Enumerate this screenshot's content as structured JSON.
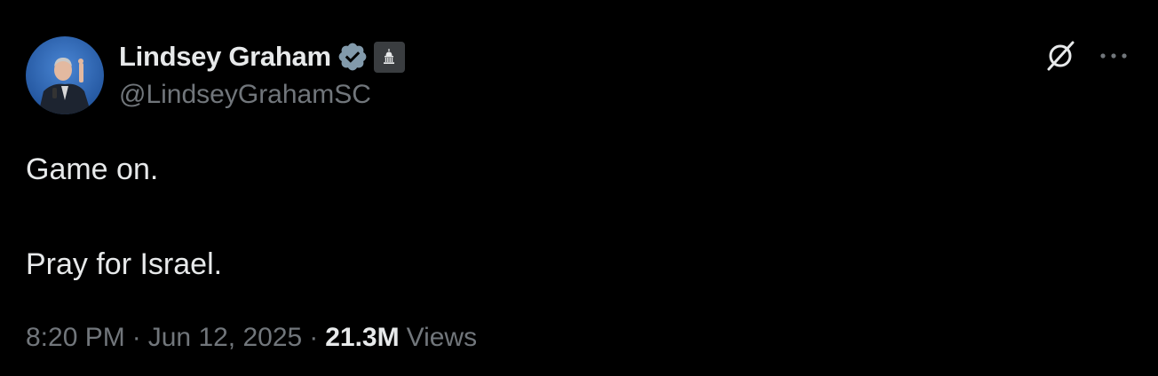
{
  "author": {
    "display_name": "Lindsey Graham",
    "handle": "@LindseyGrahamSC",
    "verified_icon": "verified-badge-icon",
    "affiliation_icon": "government-building-icon"
  },
  "tweet": {
    "lines": [
      "Game on.",
      "Pray for Israel."
    ]
  },
  "meta": {
    "time": "8:20 PM",
    "separator": "·",
    "date": "Jun 12, 2025",
    "views_count": "21.3M",
    "views_label": "Views"
  },
  "actions": {
    "grok_icon": "grok-icon",
    "more_icon": "more-options-icon"
  },
  "colors": {
    "background": "#000000",
    "primary_text": "#e7e9ea",
    "secondary_text": "#71767b",
    "verified_badge": "#829aab"
  }
}
